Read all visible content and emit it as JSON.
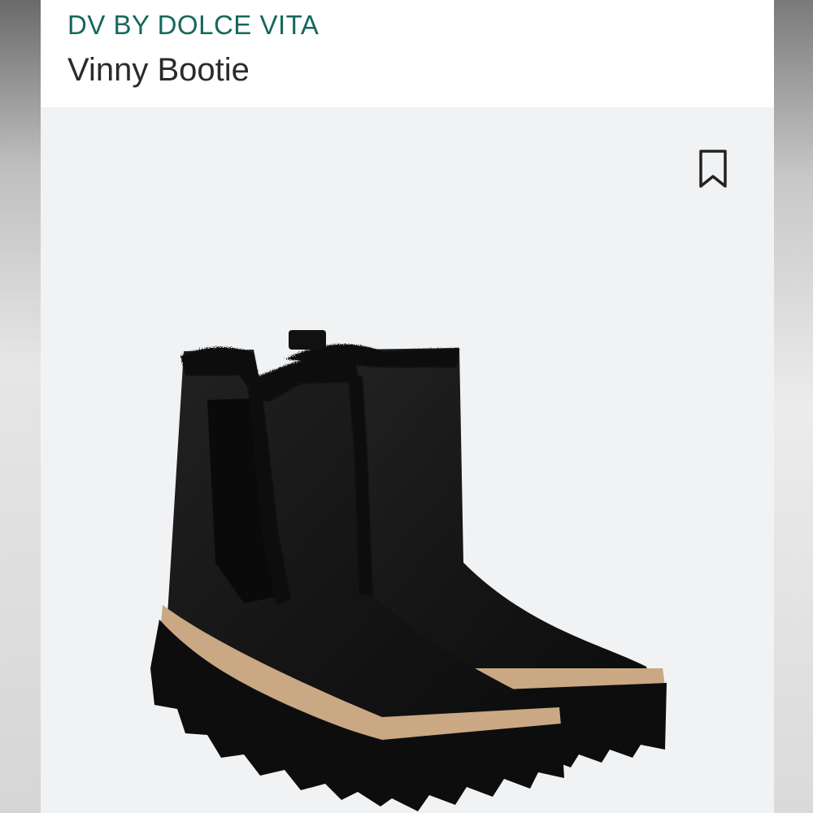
{
  "product": {
    "brand": "DV BY DOLCE VITA",
    "title": "Vinny Bootie"
  },
  "actions": {
    "save_icon": "bookmark-icon"
  },
  "image": {
    "subject": "product-photo"
  },
  "colors": {
    "brand": "#16675c",
    "title": "#2b2b2b",
    "background": "#f1f2f4",
    "boot": "#141414",
    "welt": "#c9a883"
  }
}
